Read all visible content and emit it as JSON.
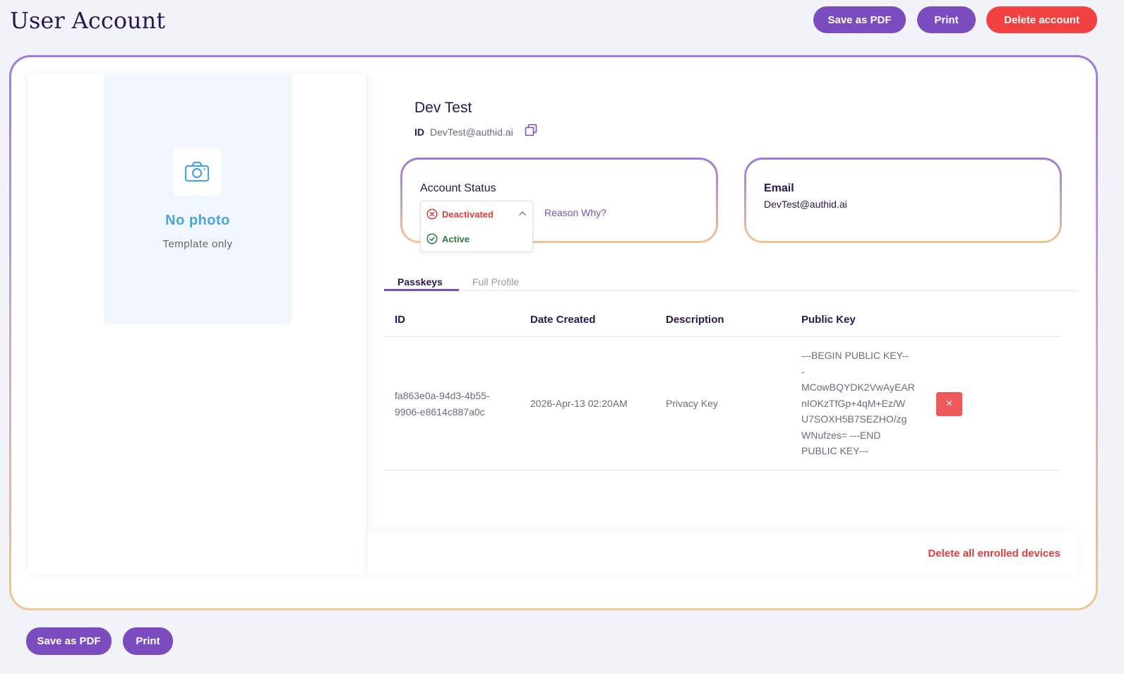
{
  "header": {
    "title": "User Account",
    "save_pdf_label": "Save as PDF",
    "print_label": "Print",
    "delete_account_label": "Delete account"
  },
  "photo": {
    "no_photo": "No photo",
    "template_only": "Template only"
  },
  "user": {
    "name": "Dev Test",
    "id_label": "ID",
    "id_value": "DevTest@authid.ai"
  },
  "account_status": {
    "title": "Account Status",
    "options": [
      {
        "label": "Deactivated",
        "selected": true
      },
      {
        "label": "Active",
        "selected": false
      }
    ],
    "reason_link": "Reason Why?"
  },
  "email_card": {
    "title": "Email",
    "value": "DevTest@authid.ai"
  },
  "tabs": [
    {
      "label": "Passkeys",
      "active": true
    },
    {
      "label": "Full Profile",
      "active": false
    }
  ],
  "table": {
    "headers": [
      "ID",
      "Date Created",
      "Description",
      "Public Key"
    ],
    "rows": [
      {
        "id": [
          "fa863e0a-94d3-4b55-",
          "9906-e8614c887a0c"
        ],
        "date_created": "2026-Apr-13 02:20AM",
        "description": "Privacy Key",
        "public_key": [
          "---BEGIN PUBLIC KEY--",
          "-",
          "MCowBQYDK2VwAyEAR",
          "nIOKzTfGp+4qM+Ez/W",
          "U7SOXH5B7SEZHO/zg",
          "WNufzes= ---END",
          "PUBLIC KEY---"
        ],
        "delete_icon": "×"
      }
    ]
  },
  "footer_bar": {
    "delete_all": "Delete all enrolled devices"
  },
  "bottom_actions": {
    "save_pdf_label": "Save as PDF",
    "print_label": "Print"
  },
  "colors": {
    "accent": "#7a4cbf",
    "danger": "#f24141",
    "success": "#2d7a3a",
    "photo_text": "#4ba3e0"
  },
  "icons": {
    "camera": "camera-icon",
    "copy": "copy-icon",
    "deactivated": "x-circle-icon",
    "active": "check-circle-icon",
    "chevron": "chevron-up-icon"
  }
}
